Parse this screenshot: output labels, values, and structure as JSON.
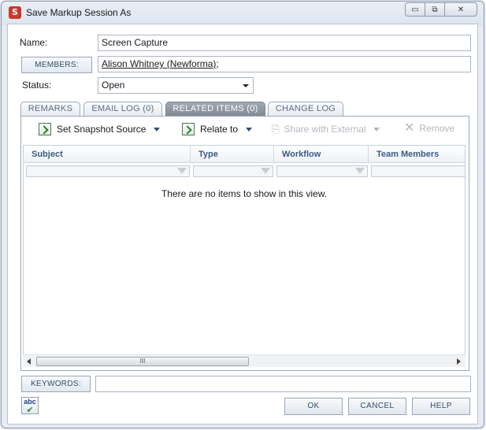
{
  "window": {
    "title": "Save Markup Session As",
    "minimize": "▭",
    "restore": "⧉",
    "close": "✕"
  },
  "form": {
    "name_label": "Name:",
    "name_value": "Screen Capture",
    "members_button": "MEMBERS:",
    "members_value": "Alison Whitney (Newforma)",
    "members_suffix": ";",
    "status_label": "Status:",
    "status_value": "Open"
  },
  "tabs": [
    {
      "label": "REMARKS"
    },
    {
      "label": "EMAIL LOG (0)"
    },
    {
      "label": "RELATED ITEMS (0)",
      "active": true
    },
    {
      "label": "CHANGE LOG"
    }
  ],
  "toolbar": {
    "set_snapshot": "Set Snapshot Source",
    "relate_to": "Relate to",
    "share_external": "Share with External",
    "remove": "Remove"
  },
  "grid": {
    "columns": [
      "Subject",
      "Type",
      "Workflow",
      "Team Members"
    ],
    "empty_message": "There are no items to show in this view."
  },
  "scrollbar": {
    "thumb_grip": "III"
  },
  "keywords": {
    "button": "KEYWORDS:",
    "value": ""
  },
  "spellcheck": {
    "line1": "abc",
    "line2": "✔"
  },
  "buttons": {
    "ok": "OK",
    "cancel": "CANCEL",
    "help": "HELP"
  },
  "colors": {
    "accent": "#3b5b84",
    "active_tab": "#8b939d",
    "border": "#9aa9bb"
  }
}
